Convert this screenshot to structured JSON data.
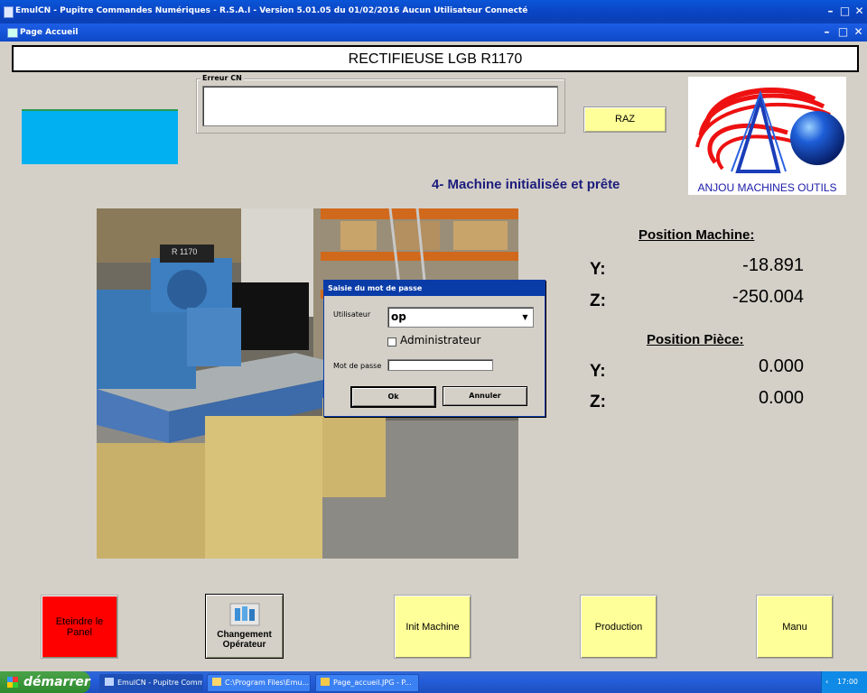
{
  "window": {
    "title": "EmulCN - Pupitre Commandes Numériques - R.S.A.I - Version 5.01.05 du 01/02/2016  Aucun Utilisateur Connecté",
    "subtitle": "Page Accueil",
    "min_glyph": "–",
    "max_glyph": "□",
    "close_glyph": "✕"
  },
  "header": {
    "machine_name": "RECTIFIEUSE LGB R1170"
  },
  "erreur": {
    "legend": "Erreur CN",
    "value": ""
  },
  "raz_label": "RAZ",
  "status_text": "4- Machine initialisée et prête",
  "logo": {
    "text": "ANJOU MACHINES OUTILS"
  },
  "position_machine": {
    "title": "Position Machine:",
    "y_label": "Y:",
    "y_value": "-18.891",
    "z_label": "Z:",
    "z_value": "-250.004"
  },
  "position_piece": {
    "title": "Position Pièce:",
    "y_label": "Y:",
    "y_value": "0.000",
    "z_label": "Z:",
    "z_value": "0.000"
  },
  "dialog": {
    "title": "Saisie du mot de passe",
    "user_label": "Utilisateur",
    "user_value": "op",
    "admin_label": "Administrateur",
    "password_label": "Mot de passe",
    "password_value": "",
    "ok_label": "Ok",
    "cancel_label": "Annuler"
  },
  "buttons": {
    "eteindre_line1": "Eteindre le",
    "eteindre_line2": "Panel",
    "changement_line1": "Changement",
    "changement_line2": "Opérateur",
    "init": "Init Machine",
    "production": "Production",
    "manu": "Manu"
  },
  "photo": {
    "plate_text": "R 1170"
  },
  "taskbar": {
    "start_label": "démarrer",
    "tasks": [
      "EmulCN - Pupitre Comm...",
      "C:\\Program Files\\Emu...",
      "Page_accueil.JPG - P..."
    ],
    "tray_arrow": "‹",
    "clock": "17:00"
  },
  "colors": {
    "accent_blue": "#00b0f0",
    "button_yellow": "#ffff99",
    "button_red": "#ff0000",
    "status_text": "#1c1c7c"
  }
}
